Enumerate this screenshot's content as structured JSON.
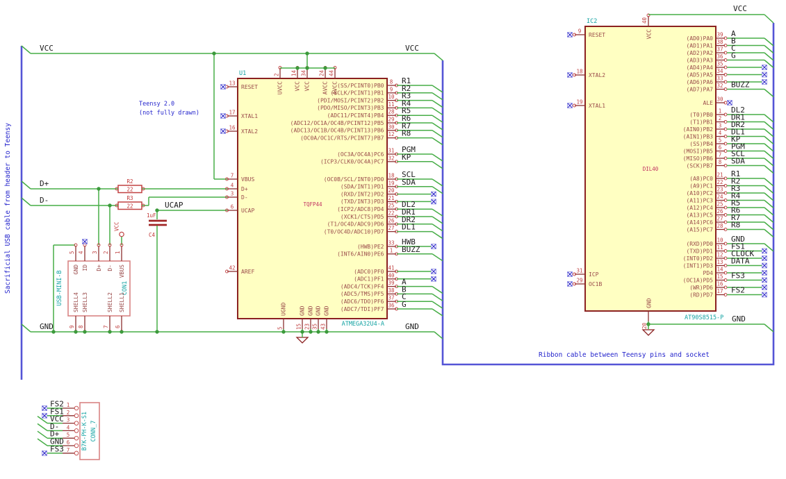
{
  "palette": {
    "wire": "#47AD47",
    "bus": "#5454D6",
    "junction": "#3C9A3C",
    "pin": "#8C2F2F",
    "pin_number": "#C04040",
    "pin_name": "#9A4A4A",
    "net_label": "#1A1A1A",
    "reference_teal": "#14A3A3",
    "value_magenta": "#C03060",
    "note_blue": "#2424CC",
    "nc_x": "#3A34CC",
    "nc_box": "#9A9AE6",
    "ic_fill": "#FFFFC2",
    "ic_outline": "#8B2121"
  },
  "notes": {
    "teensy_line1": "Teensy 2.0",
    "teensy_line2": "(not fully drawn)",
    "ribbon": "Ribbon cable between Teensy pins and socket",
    "usb_cable": "Sacrificial USB cable from header to Teensy"
  },
  "net_labels": {
    "vcc_left": "VCC",
    "vcc_right": "VCC",
    "gnd_left": "GND",
    "gnd_right": "GND",
    "dplus": "D+",
    "dminus": "D-",
    "ucap": "UCAP",
    "vcc_ic2": "VCC",
    "gnd_ic2_bottom": "GND",
    "vbus_power": "VCC"
  },
  "u1": {
    "ref": "U1",
    "value": "TQFP44",
    "part": "ATMEGA32U4-A",
    "top_pins": [
      {
        "num": "2",
        "name": "UVCC"
      },
      {
        "num": "14",
        "name": "VCC"
      },
      {
        "num": "34",
        "name": "VCC"
      },
      {
        "num": "24",
        "name": "AVCC"
      },
      {
        "num": "44",
        "name": "AVCC"
      }
    ],
    "bottom_pins": [
      {
        "num": "5",
        "name": "UGND"
      },
      {
        "num": "15",
        "name": "GND"
      },
      {
        "num": "23",
        "name": "GND"
      },
      {
        "num": "35",
        "name": "GND"
      },
      {
        "num": "43",
        "name": "GND"
      }
    ],
    "left_pins": [
      {
        "num": "13",
        "name": "RESET",
        "nc": true
      },
      {
        "num": "17",
        "name": "XTAL1",
        "nc": true
      },
      {
        "num": "16",
        "name": "XTAL2",
        "nc": true
      },
      {
        "num": "7",
        "name": "VBUS"
      },
      {
        "num": "4",
        "name": "D+"
      },
      {
        "num": "3",
        "name": "D-"
      },
      {
        "num": "6",
        "name": "UCAP"
      },
      {
        "num": "42",
        "name": "AREF"
      }
    ],
    "right_pins": [
      {
        "num": "8",
        "name": "(SS/PCINT0)PB0",
        "label": "R1",
        "end": "bus"
      },
      {
        "num": "9",
        "name": "(SCLK/PCINT1)PB1",
        "label": "R2",
        "end": "bus"
      },
      {
        "num": "10",
        "name": "(PDI/MOSI/PCINT2)PB2",
        "label": "R3",
        "end": "bus"
      },
      {
        "num": "11",
        "name": "(PDO/MISO/PCINT3)PB3",
        "label": "R4",
        "end": "bus"
      },
      {
        "num": "28",
        "name": "(ADC11/PCINT4)PB4",
        "label": "R5",
        "end": "bus"
      },
      {
        "num": "29",
        "name": "(ADC12/OC1A/OC4B/PCINT12)PB5",
        "label": "R6",
        "end": "bus"
      },
      {
        "num": "30",
        "name": "(ADC13/OC1B/OC4B/PCINT13)PB6",
        "label": "R7",
        "end": "bus"
      },
      {
        "num": "12",
        "name": "(OC0A/OC1C/RTS/PCINT7)PB7",
        "label": "R8",
        "end": "bus"
      },
      {
        "num": "31",
        "name": "(OC3A/OC4A)PC6",
        "label": "PGM",
        "end": "bus"
      },
      {
        "num": "32",
        "name": "(ICP3/CLK0/OC4A)PC7",
        "label": "KP",
        "end": "bus"
      },
      {
        "num": "18",
        "name": "(OC0B/SCL/INT0)PD0",
        "label": "SCL",
        "end": "bus"
      },
      {
        "num": "19",
        "name": "(SDA/INT1)PD1",
        "label": "SDA",
        "end": "bus"
      },
      {
        "num": "20",
        "name": "(RXD/INT2)PD2",
        "label": "",
        "end": "nc"
      },
      {
        "num": "21",
        "name": "(TXD/INT3)PD3",
        "label": "",
        "end": "nc"
      },
      {
        "num": "25",
        "name": "(ICP2/ADC8)PD4",
        "label": "DL2",
        "end": "bus"
      },
      {
        "num": "22",
        "name": "(XCK1/CTS)PD5",
        "label": "DR1",
        "end": "bus"
      },
      {
        "num": "26",
        "name": "(T1/OC4D/ADC9)PD6",
        "label": "DR2",
        "end": "bus"
      },
      {
        "num": "27",
        "name": "(T0/OC4D/ADC10)PD7",
        "label": "DL1",
        "end": "bus"
      },
      {
        "num": "33",
        "name": "(HWB)PE2",
        "label": "HWB",
        "end": "nc"
      },
      {
        "num": "1",
        "name": "(INT6/AIN0)PE6",
        "label": "BUZZ",
        "end": "bus"
      },
      {
        "num": "41",
        "name": "(ADC0)PF0",
        "label": "",
        "end": "nc"
      },
      {
        "num": "40",
        "name": "(ADC1)PF1",
        "label": "",
        "end": "nc"
      },
      {
        "num": "39",
        "name": "(ADC4/TCK)PF4",
        "label": "A",
        "end": "bus"
      },
      {
        "num": "38",
        "name": "(ADC5/TMS)PF5",
        "label": "B",
        "end": "bus"
      },
      {
        "num": "37",
        "name": "(ADC6/TDO)PF6",
        "label": "C",
        "end": "bus"
      },
      {
        "num": "36",
        "name": "(ADC7/TDI)PF7",
        "label": "G",
        "end": "bus"
      }
    ]
  },
  "ic2": {
    "ref": "IC2",
    "value": "DIL40",
    "part": "AT90S8515-P",
    "top_pin": {
      "num": "40",
      "name": "VCC"
    },
    "bottom_pin": {
      "num": "20",
      "name": "GND"
    },
    "left_pins": [
      {
        "num": "9",
        "name": "RESET",
        "nc": true
      },
      {
        "num": "18",
        "name": "XTAL2",
        "nc": true
      },
      {
        "num": "19",
        "name": "XTAL1",
        "nc": true
      },
      {
        "num": "31",
        "name": "ICP",
        "nc": true
      },
      {
        "num": "29",
        "name": "OC1B",
        "nc": true
      }
    ],
    "right_pins": [
      {
        "num": "39",
        "name": "(AD0)PA0",
        "label": "A",
        "end": "bus"
      },
      {
        "num": "38",
        "name": "(AD1)PA1",
        "label": "B",
        "end": "bus"
      },
      {
        "num": "37",
        "name": "(AD2)PA2",
        "label": "C",
        "end": "bus"
      },
      {
        "num": "36",
        "name": "(AD3)PA3",
        "label": "G",
        "end": "bus"
      },
      {
        "num": "35",
        "name": "(AD4)PA4",
        "label": "",
        "end": "nc"
      },
      {
        "num": "34",
        "name": "(AD5)PA5",
        "label": "",
        "end": "nc"
      },
      {
        "num": "33",
        "name": "(AD6)PA6",
        "label": "",
        "end": "nc"
      },
      {
        "num": "32",
        "name": "(AD7)PA7",
        "label": "BUZZ",
        "end": "bus"
      },
      {
        "num": "30",
        "name": "ALE",
        "label": "",
        "end": "ncpin"
      },
      {
        "num": "1",
        "name": "(T0)PB0",
        "label": "DL2",
        "end": "bus"
      },
      {
        "num": "2",
        "name": "(T1)PB1",
        "label": "DR1",
        "end": "bus"
      },
      {
        "num": "3",
        "name": "(AIN0)PB2",
        "label": "DR2",
        "end": "bus"
      },
      {
        "num": "4",
        "name": "(AIN1)PB3",
        "label": "DL1",
        "end": "bus"
      },
      {
        "num": "5",
        "name": "(SS)PB4",
        "label": "KP",
        "end": "bus"
      },
      {
        "num": "6",
        "name": "(MOSI)PB5",
        "label": "PGM",
        "end": "bus"
      },
      {
        "num": "7",
        "name": "(MISO)PB6",
        "label": "SCL",
        "end": "bus"
      },
      {
        "num": "8",
        "name": "(SCK)PB7",
        "label": "SDA",
        "end": "bus"
      },
      {
        "num": "21",
        "name": "(A8)PC0",
        "label": "R1",
        "end": "bus"
      },
      {
        "num": "22",
        "name": "(A9)PC1",
        "label": "R2",
        "end": "bus"
      },
      {
        "num": "23",
        "name": "(A10)PC2",
        "label": "R3",
        "end": "bus"
      },
      {
        "num": "24",
        "name": "(A11)PC3",
        "label": "R4",
        "end": "bus"
      },
      {
        "num": "25",
        "name": "(A12)PC4",
        "label": "R5",
        "end": "bus"
      },
      {
        "num": "26",
        "name": "(A13)PC5",
        "label": "R6",
        "end": "bus"
      },
      {
        "num": "27",
        "name": "(A14)PC6",
        "label": "R7",
        "end": "bus"
      },
      {
        "num": "28",
        "name": "(A15)PC7",
        "label": "R8",
        "end": "bus"
      },
      {
        "num": "10",
        "name": "(RXD)PD0",
        "label": "GND",
        "end": "bus"
      },
      {
        "num": "11",
        "name": "(TXD)PD1",
        "label": "FS1",
        "end": "nc"
      },
      {
        "num": "12",
        "name": "(INT0)PD2",
        "label": "CLOCK",
        "end": "nc"
      },
      {
        "num": "13",
        "name": "(INT1)PD3",
        "label": "DATA",
        "end": "nc"
      },
      {
        "num": "14",
        "name": "PD4",
        "label": "",
        "end": "nc"
      },
      {
        "num": "15",
        "name": "(OC1A)PD5",
        "label": "FS3",
        "end": "nc"
      },
      {
        "num": "16",
        "name": "(WR)PD6",
        "label": "",
        "end": "nc"
      },
      {
        "num": "17",
        "name": "(RD)PD7",
        "label": "FS2",
        "end": "nc"
      }
    ]
  },
  "con1": {
    "ref": "CON1",
    "value": "USB-MINI-B",
    "top_pins": [
      {
        "num": "5",
        "name": "GND"
      },
      {
        "num": "4",
        "name": "ID"
      },
      {
        "num": "3",
        "name": "D+"
      },
      {
        "num": "2",
        "name": "D-"
      },
      {
        "num": "1",
        "name": "VBUS"
      }
    ],
    "bottom_pins": [
      {
        "num": "9",
        "name": "SHELL4"
      },
      {
        "num": "8",
        "name": "SHELL3"
      },
      {
        "num": "7",
        "name": "SHELL2"
      },
      {
        "num": "6",
        "name": "SHELL1"
      }
    ]
  },
  "conn7": {
    "ref": "CONN_7",
    "value": "B7K-PH-K-S1",
    "pins": [
      {
        "num": "1",
        "label": "FS2",
        "end": "nc"
      },
      {
        "num": "2",
        "label": "FS1",
        "end": "nc"
      },
      {
        "num": "3",
        "label": "VCC",
        "end": "diag"
      },
      {
        "num": "4",
        "label": "D-",
        "end": "diag"
      },
      {
        "num": "5",
        "label": "D+",
        "end": "diag"
      },
      {
        "num": "6",
        "label": "GND",
        "end": "diag"
      },
      {
        "num": "7",
        "label": "FS3",
        "end": "nc"
      }
    ]
  },
  "r2": {
    "ref": "R2",
    "value": "22"
  },
  "r3": {
    "ref": "R3",
    "value": "22"
  },
  "c4": {
    "ref": "C4",
    "value": "1uF"
  }
}
